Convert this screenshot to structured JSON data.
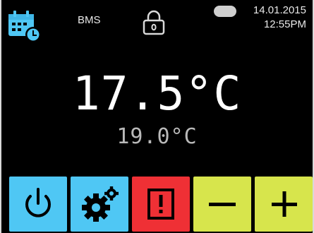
{
  "header": {
    "mode_label": "BMS",
    "date": "14.01.2015",
    "time": "12:55PM"
  },
  "temperature": {
    "setpoint": "17.5°C",
    "actual": "19.0°C"
  },
  "icons": {
    "calendar": "calendar-clock-icon",
    "lock": "lock-icon",
    "toggle": "toggle-icon",
    "power": "power-icon",
    "settings": "gears-icon",
    "alarm": "alarm-icon",
    "minus": "minus-icon",
    "plus": "plus-icon"
  },
  "colors": {
    "blue": "#4fc7f4",
    "red": "#ef3035",
    "lime": "#d7e54c",
    "background": "#000000",
    "text": "#e9e9e9"
  }
}
